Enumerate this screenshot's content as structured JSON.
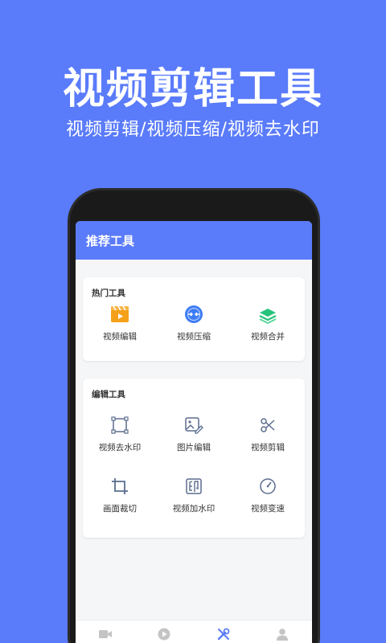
{
  "promo": {
    "title": "视频剪辑工具",
    "subtitle": "视频剪辑/视频压缩/视频去水印"
  },
  "appbar": {
    "title": "推荐工具"
  },
  "hot_tools": {
    "title": "热门工具",
    "items": [
      {
        "label": "视频编辑",
        "icon": "clapperboard-icon",
        "color": "#f5a01a"
      },
      {
        "label": "视频压缩",
        "icon": "compress-icon",
        "color": "#3d7bf5"
      },
      {
        "label": "视频合并",
        "icon": "layers-icon",
        "color": "#27c37b"
      }
    ]
  },
  "edit_tools": {
    "title": "编辑工具",
    "items": [
      {
        "label": "视频去水印",
        "icon": "square-crop-icon"
      },
      {
        "label": "图片编辑",
        "icon": "image-edit-icon"
      },
      {
        "label": "视频剪辑",
        "icon": "scissors-icon"
      },
      {
        "label": "画面裁切",
        "icon": "crop-icon"
      },
      {
        "label": "视频加水印",
        "icon": "stamp-icon"
      },
      {
        "label": "视频变速",
        "icon": "speed-icon"
      }
    ],
    "icon_color": "#5b6d8e"
  },
  "tabbar": {
    "tabs": [
      {
        "label": "录制",
        "icon": "video-camera-icon",
        "active": false
      },
      {
        "label": "视频",
        "icon": "play-icon",
        "active": false
      },
      {
        "label": "工具",
        "icon": "tools-icon",
        "active": true
      },
      {
        "label": "我的",
        "icon": "user-icon",
        "active": false
      }
    ],
    "active_color": "#5a7bfa",
    "inactive_color": "#c4c4c4"
  },
  "colors": {
    "background": "#5a7bfa",
    "accent": "#5a7bfa"
  }
}
